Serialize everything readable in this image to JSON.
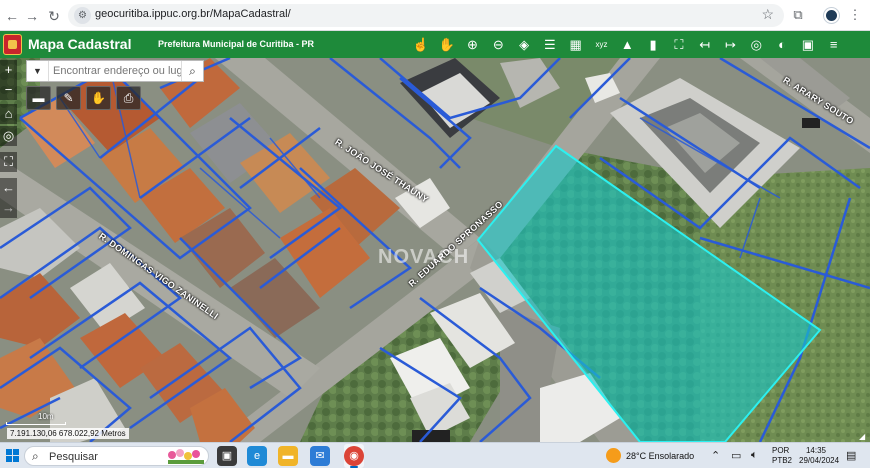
{
  "browser": {
    "url": "geocuritiba.ippuc.org.br/MapaCadastral/",
    "back_icon": "arrow-left-icon",
    "forward_icon": "arrow-right-icon",
    "reload_icon": "reload-icon",
    "site_icon": "site-settings-icon",
    "bookmark_icon": "star-icon"
  },
  "app": {
    "title": "Mapa Cadastral",
    "subtitle": "Prefeitura Municipal de Curitiba - PR",
    "brand_color": "#1e8a3a",
    "toolbar": [
      {
        "name": "identify-tool",
        "icon": "☝"
      },
      {
        "name": "pan-tool",
        "icon": "✋"
      },
      {
        "name": "zoom-in-tool",
        "icon": "⊕"
      },
      {
        "name": "zoom-out-tool",
        "icon": "⊖"
      },
      {
        "name": "layers-tool",
        "icon": "◈"
      },
      {
        "name": "legend-tool",
        "icon": "☰"
      },
      {
        "name": "grid-tool",
        "icon": "▦"
      },
      {
        "name": "coordinates-tool",
        "icon": "xyz"
      },
      {
        "name": "education-tool",
        "icon": "▲"
      },
      {
        "name": "bookmark-tool",
        "icon": "▮"
      },
      {
        "name": "fullscreen-tool",
        "icon": "⛶"
      },
      {
        "name": "login-tool",
        "icon": "↤"
      },
      {
        "name": "logout-tool",
        "icon": "↦"
      },
      {
        "name": "target-tool",
        "icon": "◎"
      },
      {
        "name": "globe-tool",
        "icon": "◐"
      },
      {
        "name": "gallery-tool",
        "icon": "▣"
      },
      {
        "name": "menu-tool",
        "icon": "≡"
      }
    ]
  },
  "search": {
    "placeholder": "Encontrar endereço ou lugar",
    "button_icon": "search-icon"
  },
  "map_tools": [
    {
      "name": "measure-tool",
      "icon": "▬"
    },
    {
      "name": "draw-tool",
      "icon": "✎"
    },
    {
      "name": "street-view-tool",
      "icon": "✋"
    },
    {
      "name": "print-tool",
      "icon": "⎙"
    }
  ],
  "zoom": {
    "in": "+",
    "out": "−",
    "home": "⌂",
    "locate": "◎",
    "extent": "⛶",
    "back": "←",
    "forward": "→"
  },
  "streets": {
    "joao": "R. JOÃO JOSÉ THAUNY",
    "eduardo": "R. EDUARDO SPRONASSO",
    "domingas": "R. DOMINGAS VIGO ZANINELLI",
    "arary": "R. ARARY SOUTO"
  },
  "watermark": "NOVACH",
  "map_overlay": {
    "selected_lot_color": "#19c6c6",
    "lot_outline_color": "#2a5bd7"
  },
  "scale": {
    "label": "10m"
  },
  "coordinates": {
    "text": "7.191.130,06 678.022,92 Metros"
  },
  "taskbar": {
    "search_label": "Pesquisar",
    "weather": "28°C  Ensolarado",
    "language_line1": "POR",
    "language_line2": "PTB2",
    "time": "14:35",
    "date": "29/04/2024"
  }
}
